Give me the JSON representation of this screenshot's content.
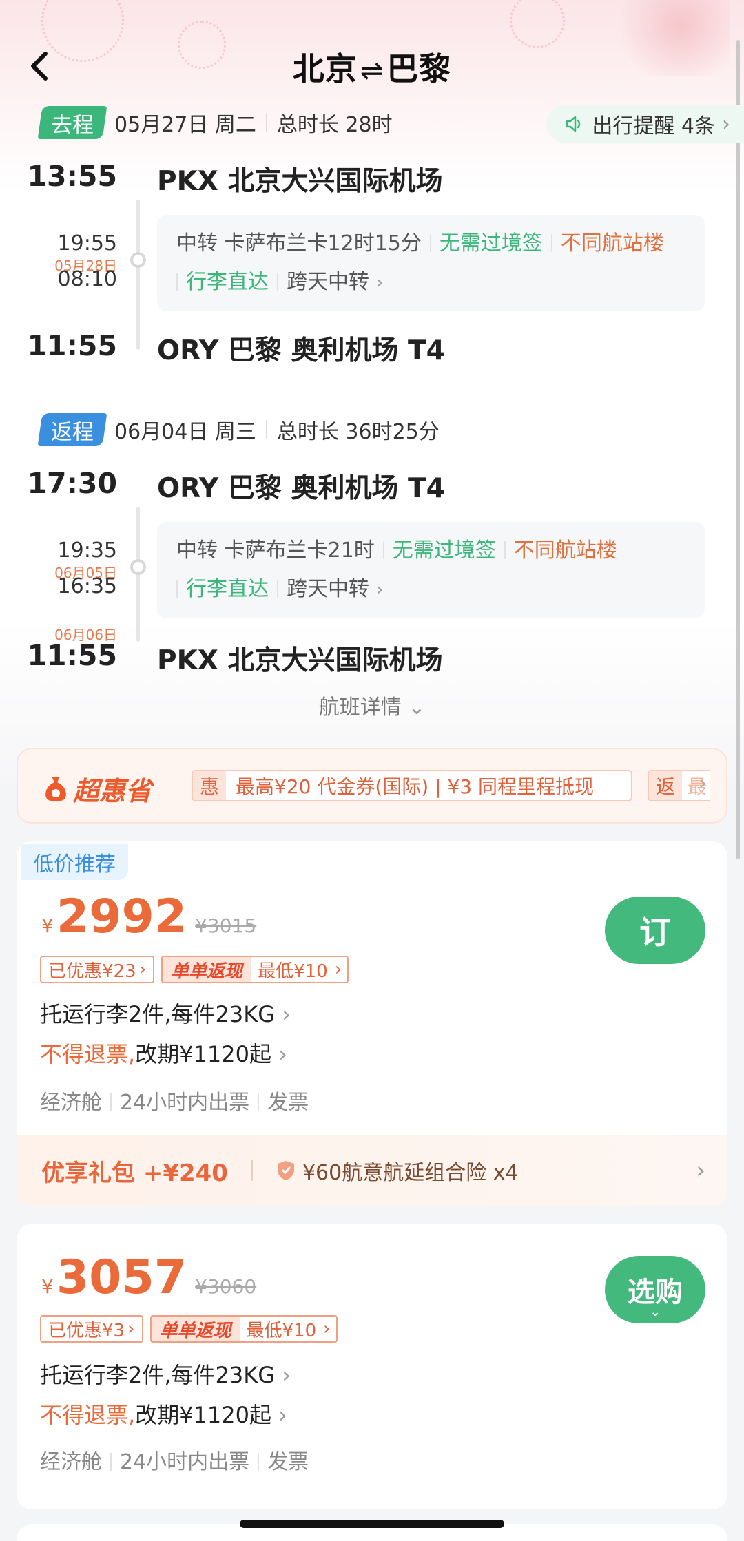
{
  "header": {
    "from": "北京",
    "arrow": "⇌",
    "to": "巴黎"
  },
  "reminder": {
    "label": "出行提醒 4条"
  },
  "outbound": {
    "tag": "去程",
    "date": "05月27日 周二",
    "duration": "总时长 28时",
    "depart_time": "13:55",
    "depart_airport": "PKX 北京大兴国际机场",
    "transfer_arrive": "19:55",
    "transfer_date": "05月28日",
    "transfer_depart": "08:10",
    "transfer_city": "中转 卡萨布兰卡12时15分",
    "no_visa": "无需过境签",
    "diff_terminal": "不同航站楼",
    "baggage": "行李直达",
    "overnight": "跨天中转",
    "arrive_time": "11:55",
    "arrive_airport": "ORY 巴黎 奥利机场 T4"
  },
  "return": {
    "tag": "返程",
    "date": "06月04日 周三",
    "duration": "总时长 36时25分",
    "depart_time": "17:30",
    "depart_airport": "ORY 巴黎 奥利机场 T4",
    "transfer_arrive": "19:35",
    "transfer_date": "06月05日",
    "transfer_depart": "16:35",
    "transfer_city": "中转 卡萨布兰卡21时",
    "no_visa": "无需过境签",
    "diff_terminal": "不同航站楼",
    "baggage": "行李直达",
    "overnight": "跨天中转",
    "arrive_date": "06月06日",
    "arrive_time": "11:55",
    "arrive_airport": "PKX 北京大兴国际机场"
  },
  "flight_details": "航班详情",
  "promo": {
    "brand": "超惠省",
    "tag": "惠",
    "text": "最高¥20 代金券(国际) | ¥3 同程里程抵现",
    "tag2": "返",
    "text2": "最"
  },
  "offers": [
    {
      "badge": "低价推荐",
      "currency": "¥",
      "price": "2992",
      "original": "¥3015",
      "discount": "已优惠¥23",
      "cashback_label": "单单返现",
      "cashback_min": "最低¥10",
      "baggage": "托运行李2件,每件23KG",
      "refund": "不得退票,",
      "change": "改期¥1120起",
      "cabin": "经济舱",
      "ticketing": "24小时内出票",
      "invoice": "发票",
      "button": "订",
      "gift_title": "优享礼包 +¥240",
      "gift_insurance": "¥60航意航延组合险 x4"
    },
    {
      "currency": "¥",
      "price": "3057",
      "original": "¥3060",
      "discount": "已优惠¥3",
      "cashback_label": "单单返现",
      "cashback_min": "最低¥10",
      "baggage": "托运行李2件,每件23KG",
      "refund": "不得退票,",
      "change": "改期¥1120起",
      "cabin": "经济舱",
      "ticketing": "24小时内出票",
      "invoice": "发票",
      "button": "选购"
    }
  ],
  "colors": {
    "green": "#3cb77c",
    "orange": "#ea6a3a",
    "blue": "#3a8fdf"
  }
}
